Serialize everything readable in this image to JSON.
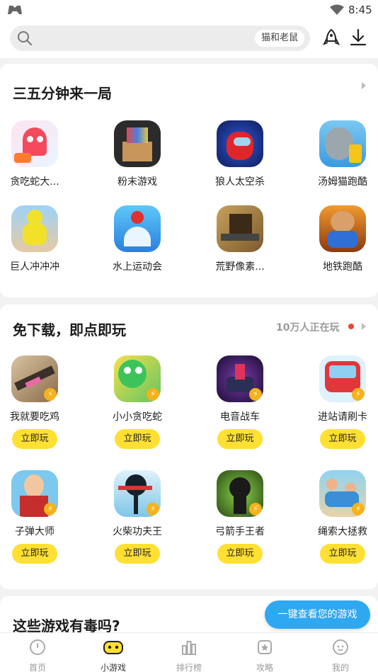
{
  "status_bar": {
    "time": "8:45"
  },
  "search": {
    "hint": "猫和老鼠"
  },
  "section_quick": {
    "title": "三五分钟来一局",
    "games": [
      {
        "name": "贪吃蛇大...",
        "icon": "snake-game-icon"
      },
      {
        "name": "粉末游戏",
        "icon": "powder-game-icon"
      },
      {
        "name": "狼人太空杀",
        "icon": "space-werewolf-icon"
      },
      {
        "name": "汤姆猫跑酷",
        "icon": "tom-cat-run-icon"
      },
      {
        "name": "巨人冲冲冲",
        "icon": "giant-rush-icon"
      },
      {
        "name": "水上运动会",
        "icon": "water-sports-icon"
      },
      {
        "name": "荒野像素...",
        "icon": "wild-pixel-icon"
      },
      {
        "name": "地铁跑酷",
        "icon": "subway-surfers-icon"
      }
    ]
  },
  "section_instant": {
    "title": "免下载，即点即玩",
    "players": "10万人正在玩",
    "play_label": "立即玩",
    "games": [
      {
        "name": "我就要吃鸡",
        "icon": "chicken-shooter-icon"
      },
      {
        "name": "小小贪吃蛇",
        "icon": "little-snake-icon"
      },
      {
        "name": "电音战车",
        "icon": "music-tank-icon"
      },
      {
        "name": "进站请刷卡",
        "icon": "bus-card-icon"
      },
      {
        "name": "子弹大师",
        "icon": "bullet-master-icon"
      },
      {
        "name": "火柴功夫王",
        "icon": "stick-kungfu-icon"
      },
      {
        "name": "弓箭手王者",
        "icon": "archer-king-icon"
      },
      {
        "name": "绳索大拯救",
        "icon": "rope-rescue-icon"
      }
    ]
  },
  "section_toxic": {
    "title": "这些游戏有毒吗?"
  },
  "float_button": "一键查看您的游戏",
  "nav": [
    {
      "label": "首页",
      "icon": "home-icon"
    },
    {
      "label": "小游戏",
      "icon": "gamepad-icon"
    },
    {
      "label": "排行榜",
      "icon": "ranking-icon"
    },
    {
      "label": "攻略",
      "icon": "guide-icon"
    },
    {
      "label": "我的",
      "icon": "profile-icon"
    }
  ]
}
